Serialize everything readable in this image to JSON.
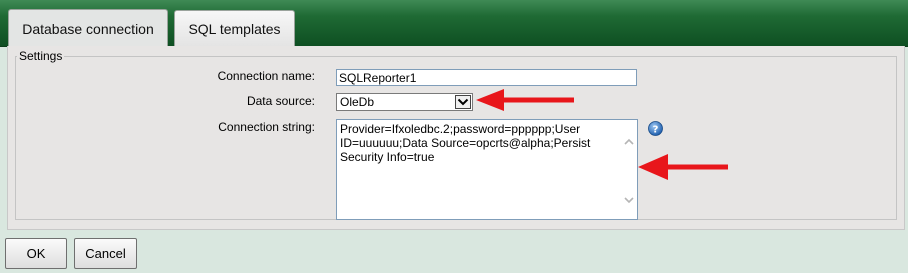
{
  "tabs": [
    {
      "label": "Database connection",
      "active": true
    },
    {
      "label": "SQL templates",
      "active": false
    }
  ],
  "settings": {
    "legend": "Settings",
    "connection_name_label": "Connection name:",
    "connection_name_value": "SQLReporter1",
    "data_source_label": "Data source:",
    "data_source_value": "OleDb",
    "connection_string_label": "Connection string:",
    "connection_string_value": "Provider=Ifxoledbc.2;password=pppppp;User ID=uuuuuu;Data Source=opcrts@alpha;Persist Security Info=true"
  },
  "buttons": {
    "ok": "OK",
    "cancel": "Cancel"
  },
  "icons": {
    "help": "help-icon",
    "dropdown": "chevron-down-icon",
    "annotation": "red-arrow-icon"
  },
  "colors": {
    "tabbar_green": "#1f6a34",
    "annotation_red": "#e8161b",
    "help_blue": "#2e6fb8"
  }
}
